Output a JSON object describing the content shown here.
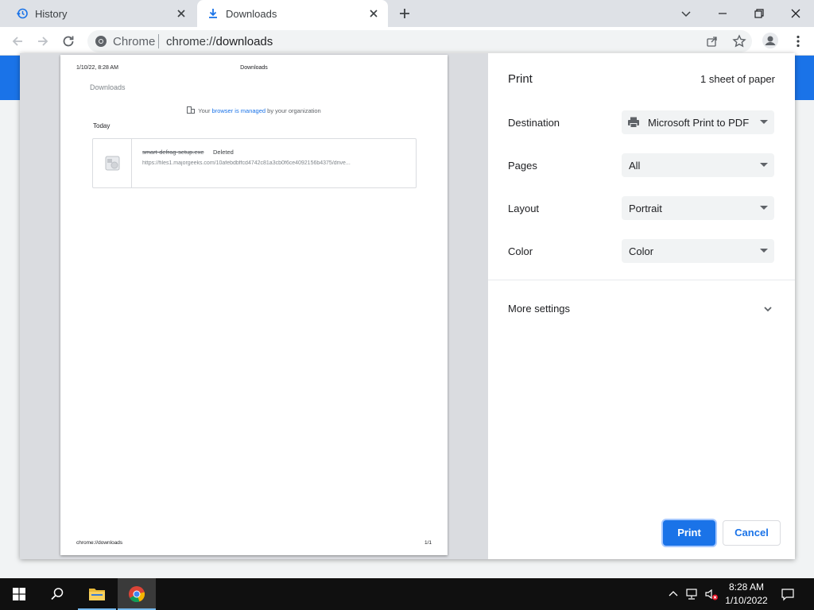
{
  "tabs": [
    {
      "label": "History",
      "icon": "history-icon"
    },
    {
      "label": "Downloads",
      "icon": "download-icon"
    }
  ],
  "omnibox": {
    "site_label": "Chrome",
    "url_scheme": "chrome://",
    "url_host": "downloads"
  },
  "preview": {
    "header_datetime": "1/10/22, 8:28 AM",
    "header_title": "Downloads",
    "page_title": "Downloads",
    "managed_prefix": "Your ",
    "managed_link": "browser is managed",
    "managed_suffix": " by your organization",
    "section_today": "Today",
    "download": {
      "filename": "smart-defrag-setup.exe",
      "status": "Deleted",
      "url": "https://files1.majorgeeks.com/10afebdbffcd4742c81a3cb0f6ce4092156b4375/drive..."
    },
    "footer_url": "chrome://downloads",
    "footer_page": "1/1"
  },
  "settings": {
    "title": "Print",
    "sheets": "1 sheet of paper",
    "rows": [
      {
        "label": "Destination",
        "value": "Microsoft Print to PDF",
        "icon": "printer-icon"
      },
      {
        "label": "Pages",
        "value": "All"
      },
      {
        "label": "Layout",
        "value": "Portrait"
      },
      {
        "label": "Color",
        "value": "Color"
      }
    ],
    "more_settings": "More settings",
    "print_button": "Print",
    "cancel_button": "Cancel"
  },
  "taskbar": {
    "time": "8:28 AM",
    "date": "1/10/2022"
  },
  "colors": {
    "accent": "#1a73e8",
    "taskbar": "#101010"
  }
}
